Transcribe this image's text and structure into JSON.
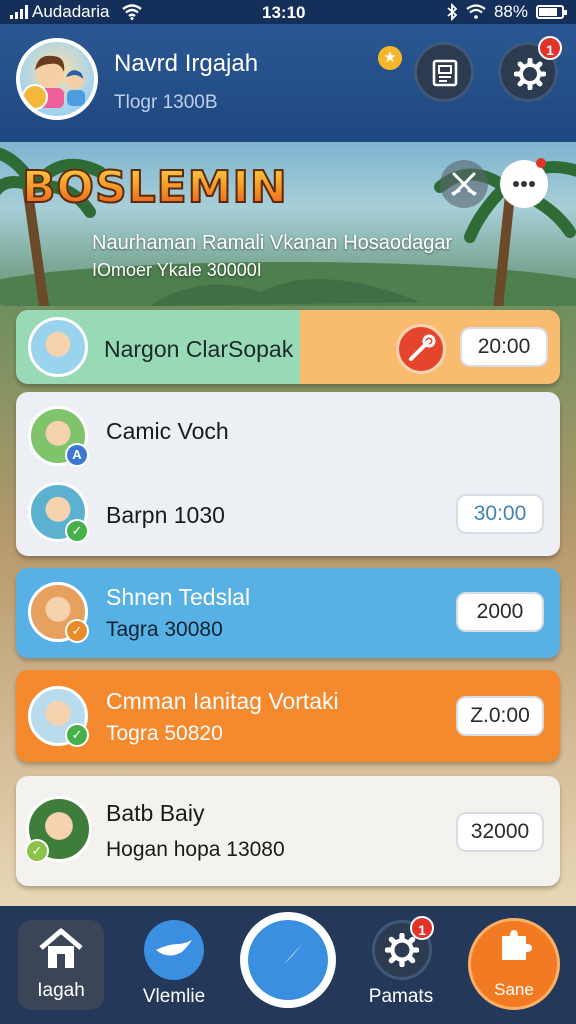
{
  "status_bar": {
    "carrier": "Audadaria",
    "time": "13:10",
    "battery": "88%"
  },
  "header": {
    "user_name": "Navrd  Irgajah",
    "user_score": "Tlogr 1300B",
    "notes_badge": "",
    "settings_badge": "1",
    "icons": [
      "notes-icon",
      "gear-icon",
      "star-icon"
    ]
  },
  "banner": {
    "title": "BOSLEMIN",
    "line1": "Naurhaman Ramali Vkanan Hosaodagar",
    "line2": "IOmoer Ykale 30000I"
  },
  "cards": [
    {
      "title": "Nargon ClarSopak",
      "time": "20:00",
      "colors": {
        "left": "#98dab6",
        "right": "#f9bb6d"
      }
    },
    {
      "title": "Camic Voch",
      "badge": "A"
    },
    {
      "title": "Barpn 1030",
      "time": "30:00"
    },
    {
      "title": "Shnen Tedslal",
      "sub": "Tagra 30080",
      "time": "2000",
      "color": "#58b1e4"
    },
    {
      "title": "Cmman Ianitag Vortaki",
      "sub": "Togra 50820",
      "time": "Z.0:00",
      "color": "#f4892d"
    },
    {
      "title": "Batb Baiy",
      "sub": "Hogan hopa 13080",
      "time": "32000"
    }
  ],
  "bottom_nav": [
    {
      "label": "Iagah",
      "icon": "home-icon"
    },
    {
      "label": "Vlemlie",
      "icon": "chat-bird-icon"
    },
    {
      "label": "",
      "icon": "compass-icon"
    },
    {
      "label": "Pamats",
      "icon": "gear-icon",
      "badge": "1"
    },
    {
      "label": "Sane",
      "icon": "puzzle-icon"
    }
  ]
}
